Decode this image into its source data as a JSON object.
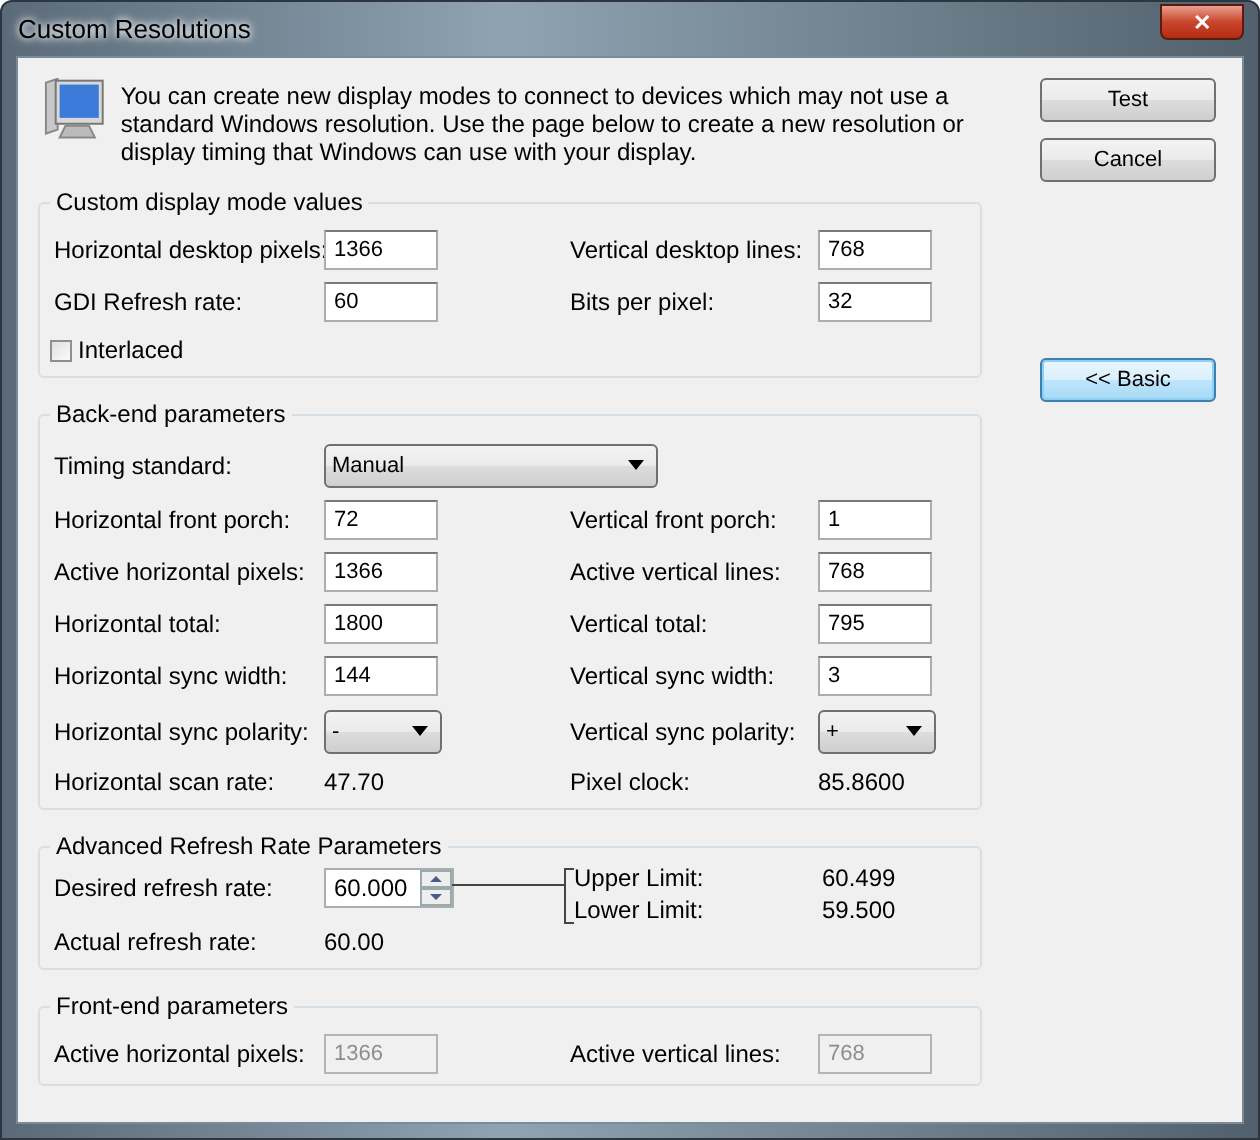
{
  "window": {
    "title": "Custom Resolutions",
    "close": "✕"
  },
  "intro": "You can create new display modes to connect to devices which may not use a standard Windows resolution. Use the page below to create a new resolution or display timing that Windows can use with your display.",
  "buttons": [
    {
      "label": "Test",
      "focused": false
    },
    {
      "label": "Cancel",
      "focused": false
    },
    {
      "label": "<< Basic",
      "focused": true
    }
  ],
  "groups": [
    {
      "title": "Custom display mode values",
      "rows": [
        [
          {
            "kind": "text",
            "label": "Horizontal desktop pixels:",
            "value": "1366",
            "disabled": false
          },
          {
            "kind": "text",
            "label": "Vertical desktop lines:",
            "value": "768",
            "disabled": false
          }
        ],
        [
          {
            "kind": "text",
            "label": "GDI Refresh rate:",
            "value": "60",
            "disabled": false
          },
          {
            "kind": "text",
            "label": "Bits per pixel:",
            "value": "32",
            "disabled": false
          }
        ],
        [
          {
            "kind": "checkbox",
            "label": "Interlaced",
            "checked": false
          }
        ]
      ]
    },
    {
      "title": "Back-end parameters",
      "rows": [
        [
          {
            "kind": "combo",
            "label": "Timing standard:",
            "value": "Manual",
            "wide": true
          }
        ],
        [
          {
            "kind": "text",
            "label": "Horizontal front porch:",
            "value": "72",
            "disabled": false
          },
          {
            "kind": "text",
            "label": "Vertical front porch:",
            "value": "1",
            "disabled": false
          }
        ],
        [
          {
            "kind": "text",
            "label": "Active horizontal pixels:",
            "value": "1366",
            "disabled": false
          },
          {
            "kind": "text",
            "label": "Active vertical lines:",
            "value": "768",
            "disabled": false
          }
        ],
        [
          {
            "kind": "text",
            "label": "Horizontal total:",
            "value": "1800",
            "disabled": false
          },
          {
            "kind": "text",
            "label": "Vertical total:",
            "value": "795",
            "disabled": false
          }
        ],
        [
          {
            "kind": "text",
            "label": "Horizontal sync width:",
            "value": "144",
            "disabled": false
          },
          {
            "kind": "text",
            "label": "Vertical sync width:",
            "value": "3",
            "disabled": false
          }
        ],
        [
          {
            "kind": "combo",
            "label": "Horizontal sync polarity:",
            "value": "-",
            "wide": false
          },
          {
            "kind": "combo",
            "label": "Vertical sync polarity:",
            "value": "+",
            "wide": false
          }
        ],
        [
          {
            "kind": "readout",
            "label": "Horizontal scan rate:",
            "value": "47.70"
          },
          {
            "kind": "readout",
            "label": "Pixel clock:",
            "value": "85.8600"
          }
        ]
      ]
    },
    {
      "title": "Advanced Refresh Rate Parameters",
      "rows": [
        [
          {
            "kind": "spin",
            "label": "Desired refresh rate:",
            "value": "60.000",
            "limits": [
              {
                "label": "Upper Limit:",
                "value": "60.499"
              },
              {
                "label": "Lower Limit:",
                "value": "59.500"
              }
            ]
          }
        ],
        [
          {
            "kind": "readout",
            "label": "Actual refresh rate:",
            "value": "60.00"
          }
        ]
      ]
    },
    {
      "title": "Front-end parameters",
      "rows": [
        [
          {
            "kind": "text",
            "label": "Active horizontal pixels:",
            "value": "1366",
            "disabled": true
          },
          {
            "kind": "text",
            "label": "Active vertical lines:",
            "value": "768",
            "disabled": true
          }
        ]
      ]
    }
  ]
}
